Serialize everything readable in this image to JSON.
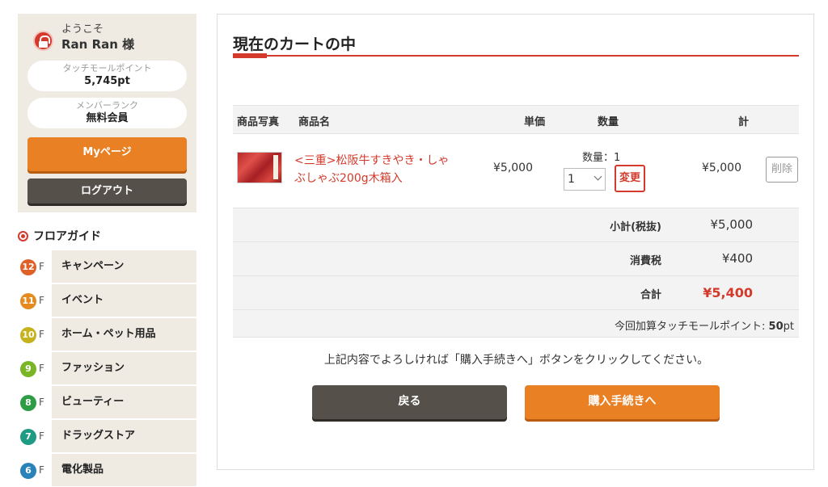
{
  "user": {
    "welcome": "ようこそ",
    "name": "Ran Ran 様",
    "points_label": "タッチモールポイント",
    "points_value": "5,745pt",
    "rank_label": "メンバーランク",
    "rank_value": "無料会員",
    "mypage_button": "Myページ",
    "logout_button": "ログアウト"
  },
  "floor_guide": {
    "title": "フロアガイド",
    "items": [
      {
        "floor": "12",
        "suffix": "F",
        "label": "キャンペーン",
        "color": "#e0602a"
      },
      {
        "floor": "11",
        "suffix": "F",
        "label": "イベント",
        "color": "#e58a1f"
      },
      {
        "floor": "10",
        "suffix": "F",
        "label": "ホーム・ペット用品",
        "color": "#c6b21d"
      },
      {
        "floor": "9",
        "suffix": "F",
        "label": "ファッション",
        "color": "#7ab526"
      },
      {
        "floor": "8",
        "suffix": "F",
        "label": "ビューティー",
        "color": "#2e9b45"
      },
      {
        "floor": "7",
        "suffix": "F",
        "label": "ドラッグストア",
        "color": "#1f9b83"
      },
      {
        "floor": "6",
        "suffix": "F",
        "label": "電化製品",
        "color": "#2a83b8"
      }
    ]
  },
  "cart": {
    "title": "現在のカートの中",
    "headers": {
      "photo": "商品写真",
      "name": "商品名",
      "unit_price": "単価",
      "quantity": "数量",
      "total": "計"
    },
    "item": {
      "name": "<三重>松阪牛すきやき・しゃぶしゃぶ200g木箱入",
      "unit_price": "¥5,000",
      "qty_label": "数量：1",
      "qty_value": "1",
      "change_button": "変更",
      "total": "¥5,000",
      "delete_button": "削除"
    },
    "subtotal_label": "小計(税抜)",
    "subtotal_value": "¥5,000",
    "tax_label": "消費税",
    "tax_value": "¥400",
    "total_label": "合計",
    "total_value": "¥5,400",
    "points_text": "今回加算タッチモールポイント:",
    "points_value": "50",
    "points_unit": "pt",
    "notice": "上記内容でよろしければ「購入手続きへ」ボタンをクリックしてください。",
    "back_button": "戻る",
    "checkout_button": "購入手続きへ"
  },
  "colors": {
    "accent_red": "#d33a2c",
    "orange": "#e98024",
    "dark": "#55504a",
    "beige": "#efebe3"
  }
}
